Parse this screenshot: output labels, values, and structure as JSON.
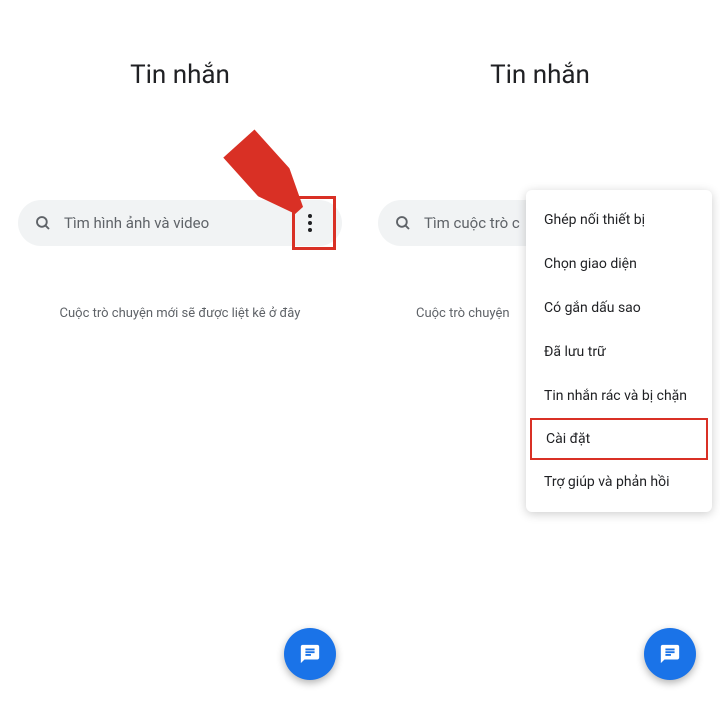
{
  "left": {
    "title": "Tin nhắn",
    "search_placeholder": "Tìm hình ảnh và video",
    "empty_state": "Cuộc trò chuyện mới sẽ được liệt kê ở đây"
  },
  "right": {
    "title": "Tin nhắn",
    "search_placeholder": "Tìm cuộc trò c",
    "empty_state": "Cuộc trò chuyện",
    "menu": {
      "items": [
        "Ghép nối thiết bị",
        "Chọn giao diện",
        "Có gắn dấu sao",
        "Đã lưu trữ",
        "Tin nhắn rác và bị chặn",
        "Cài đặt",
        "Trợ giúp và phản hồi"
      ]
    }
  }
}
